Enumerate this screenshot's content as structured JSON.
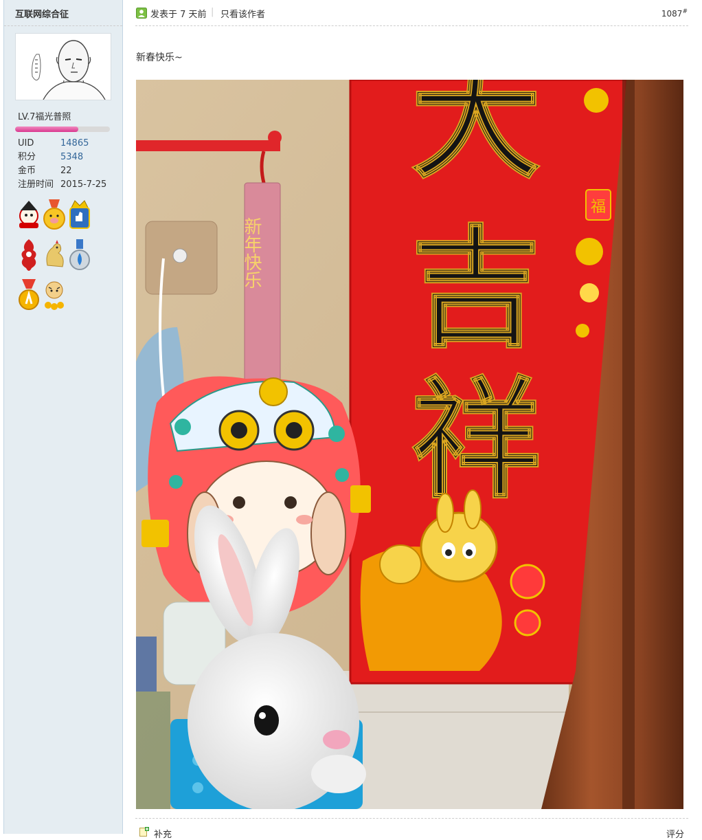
{
  "author": {
    "name": "互联网综合征",
    "level": "LV.7福光普照",
    "level_progress": 0.67,
    "stats": [
      {
        "label": "UID",
        "value": "14865",
        "link": true
      },
      {
        "label": "积分",
        "value": "5348",
        "link": true
      },
      {
        "label": "金币",
        "value": "22",
        "link": false
      },
      {
        "label": "注册时间",
        "value": "2015-7-25",
        "link": false
      }
    ],
    "medals": [
      "fortune-boy-medal-icon",
      "golden-pig-medal-icon",
      "crown-like-medal-icon",
      "red-dragon-medal-icon",
      "golden-rooster-medal-icon",
      "water-drop-medal-icon",
      "gold-medal-icon",
      "tiger-medal-icon"
    ]
  },
  "post": {
    "time": "发表于 7 天前",
    "separator": "|",
    "author_only": "只看该作者",
    "floor": "1087",
    "floor_mark": "#",
    "text": "新春快乐~",
    "image": {
      "couplet_chars": [
        "大",
        "吉",
        "祥"
      ],
      "hanging_tag_text": "新年快乐",
      "fu_character": "福"
    },
    "supplement": "补充",
    "rate": "评分"
  },
  "colors": {
    "sidebar_bg": "#e5edf2",
    "link": "#336699",
    "level_bar": "#d9378e"
  }
}
